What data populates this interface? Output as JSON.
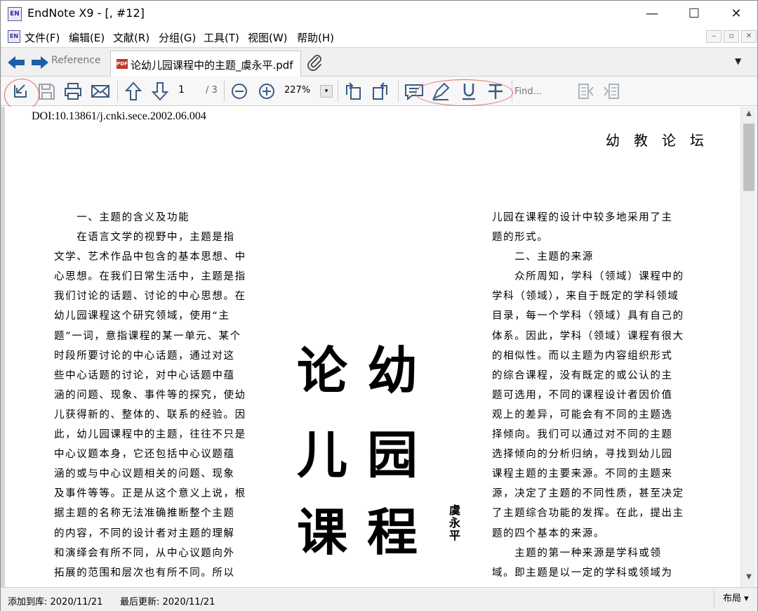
{
  "window": {
    "app_icon": "EN",
    "title": "EndNote X9 - [,  #12]",
    "minimize": "—",
    "maximize": "☐",
    "close": "✕"
  },
  "menubar": {
    "items": [
      {
        "label": "文件(F)"
      },
      {
        "label": "编辑(E)"
      },
      {
        "label": "文献(R)"
      },
      {
        "label": "分组(G)"
      },
      {
        "label": "工具(T)"
      },
      {
        "label": "视图(W)"
      },
      {
        "label": "帮助(H)"
      }
    ],
    "mdi_minimize": "‒",
    "mdi_restore": "▫",
    "mdi_close": "✕"
  },
  "tabs": {
    "reference_label": "Reference",
    "pdf_badge": "PDF",
    "pdf_label": "论幼儿园课程中的主题_虞永平.pdf",
    "dropdown": "▼"
  },
  "toolbar": {
    "page_current": "1",
    "page_total": "/ 3",
    "zoom": "227%",
    "zoom_dropdown": "▾",
    "find_placeholder": "Find...",
    "icons": [
      "open-in-window-icon",
      "save-icon",
      "print-icon",
      "email-icon",
      "page-up-icon",
      "page-down-icon",
      "zoom-out-icon",
      "zoom-in-icon",
      "rotate-left-icon",
      "rotate-right-icon",
      "sticky-note-icon",
      "highlight-icon",
      "underline-icon",
      "strikethrough-icon",
      "find-previous-icon",
      "find-next-icon"
    ],
    "annotation_color": "#e26a6a"
  },
  "document": {
    "doi": "DOI:10.13861/j.cnki.sece.2002.06.004",
    "section_header": "幼教论坛",
    "big_title_lines": [
      {
        "left": "论",
        "right": "幼"
      },
      {
        "left": "儿",
        "right": "园"
      },
      {
        "left": "课",
        "right": "程"
      }
    ],
    "author": "虞永平",
    "left_column": [
      "　　一、主题的含义及功能",
      "　　在语言文学的视野中，主题是指",
      "文学、艺术作品中包含的基本思想、中",
      "心思想。在我们日常生活中，主题是指",
      "我们讨论的话题、讨论的中心思想。在",
      "幼儿园课程这个研究领域，使用“主",
      "题”一词，意指课程的某一单元、某个",
      "时段所要讨论的中心话题，通过对这",
      "些中心话题的讨论，对中心话题中蕴",
      "涵的问题、现象、事件等的探究，使幼",
      "儿获得新的、整体的、联系的经验。因",
      "此，幼儿园课程中的主题，往往不只是",
      "中心议题本身，它还包括中心议题蕴",
      "涵的或与中心议题相关的问题、现象",
      "及事件等等。正是从这个意义上说，根",
      "据主题的名称无法准确推断整个主题",
      "的内容，不同的设计者对主题的理解",
      "和演绎会有所不同，从中心议题向外",
      "拓展的范围和层次也有所不同。所以"
    ],
    "right_column": [
      "儿园在课程的设计中较多地采用了主",
      "题的形式。",
      "　　二、主题的来源",
      "　　众所周知，学科（领域）课程中的",
      "学科（领域），来自于既定的学科领域",
      "目录，每一个学科（领域）具有自己的",
      "体系。因此，学科（领域）课程有很大",
      "的相似性。而以主题为内容组织形式",
      "的综合课程，没有既定的或公认的主",
      "题可选用，不同的课程设计者因价值",
      "观上的差异，可能会有不同的主题选",
      "择倾向。我们可以通过对不同的主题",
      "选择倾向的分析归纳，寻找到幼儿园",
      "课程主题的主要来源。不同的主题来",
      "源，决定了主题的不同性质，甚至决定",
      "了主题综合功能的发挥。在此，提出主",
      "题的四个基本的来源。",
      "　　主题的第一种来源是学科或领",
      "域。即主题是以一定的学科或领域为"
    ]
  },
  "statusbar": {
    "added": "添加到库: 2020/11/21",
    "updated": "最后更新: 2020/11/21",
    "layout": "布局 ▾"
  }
}
